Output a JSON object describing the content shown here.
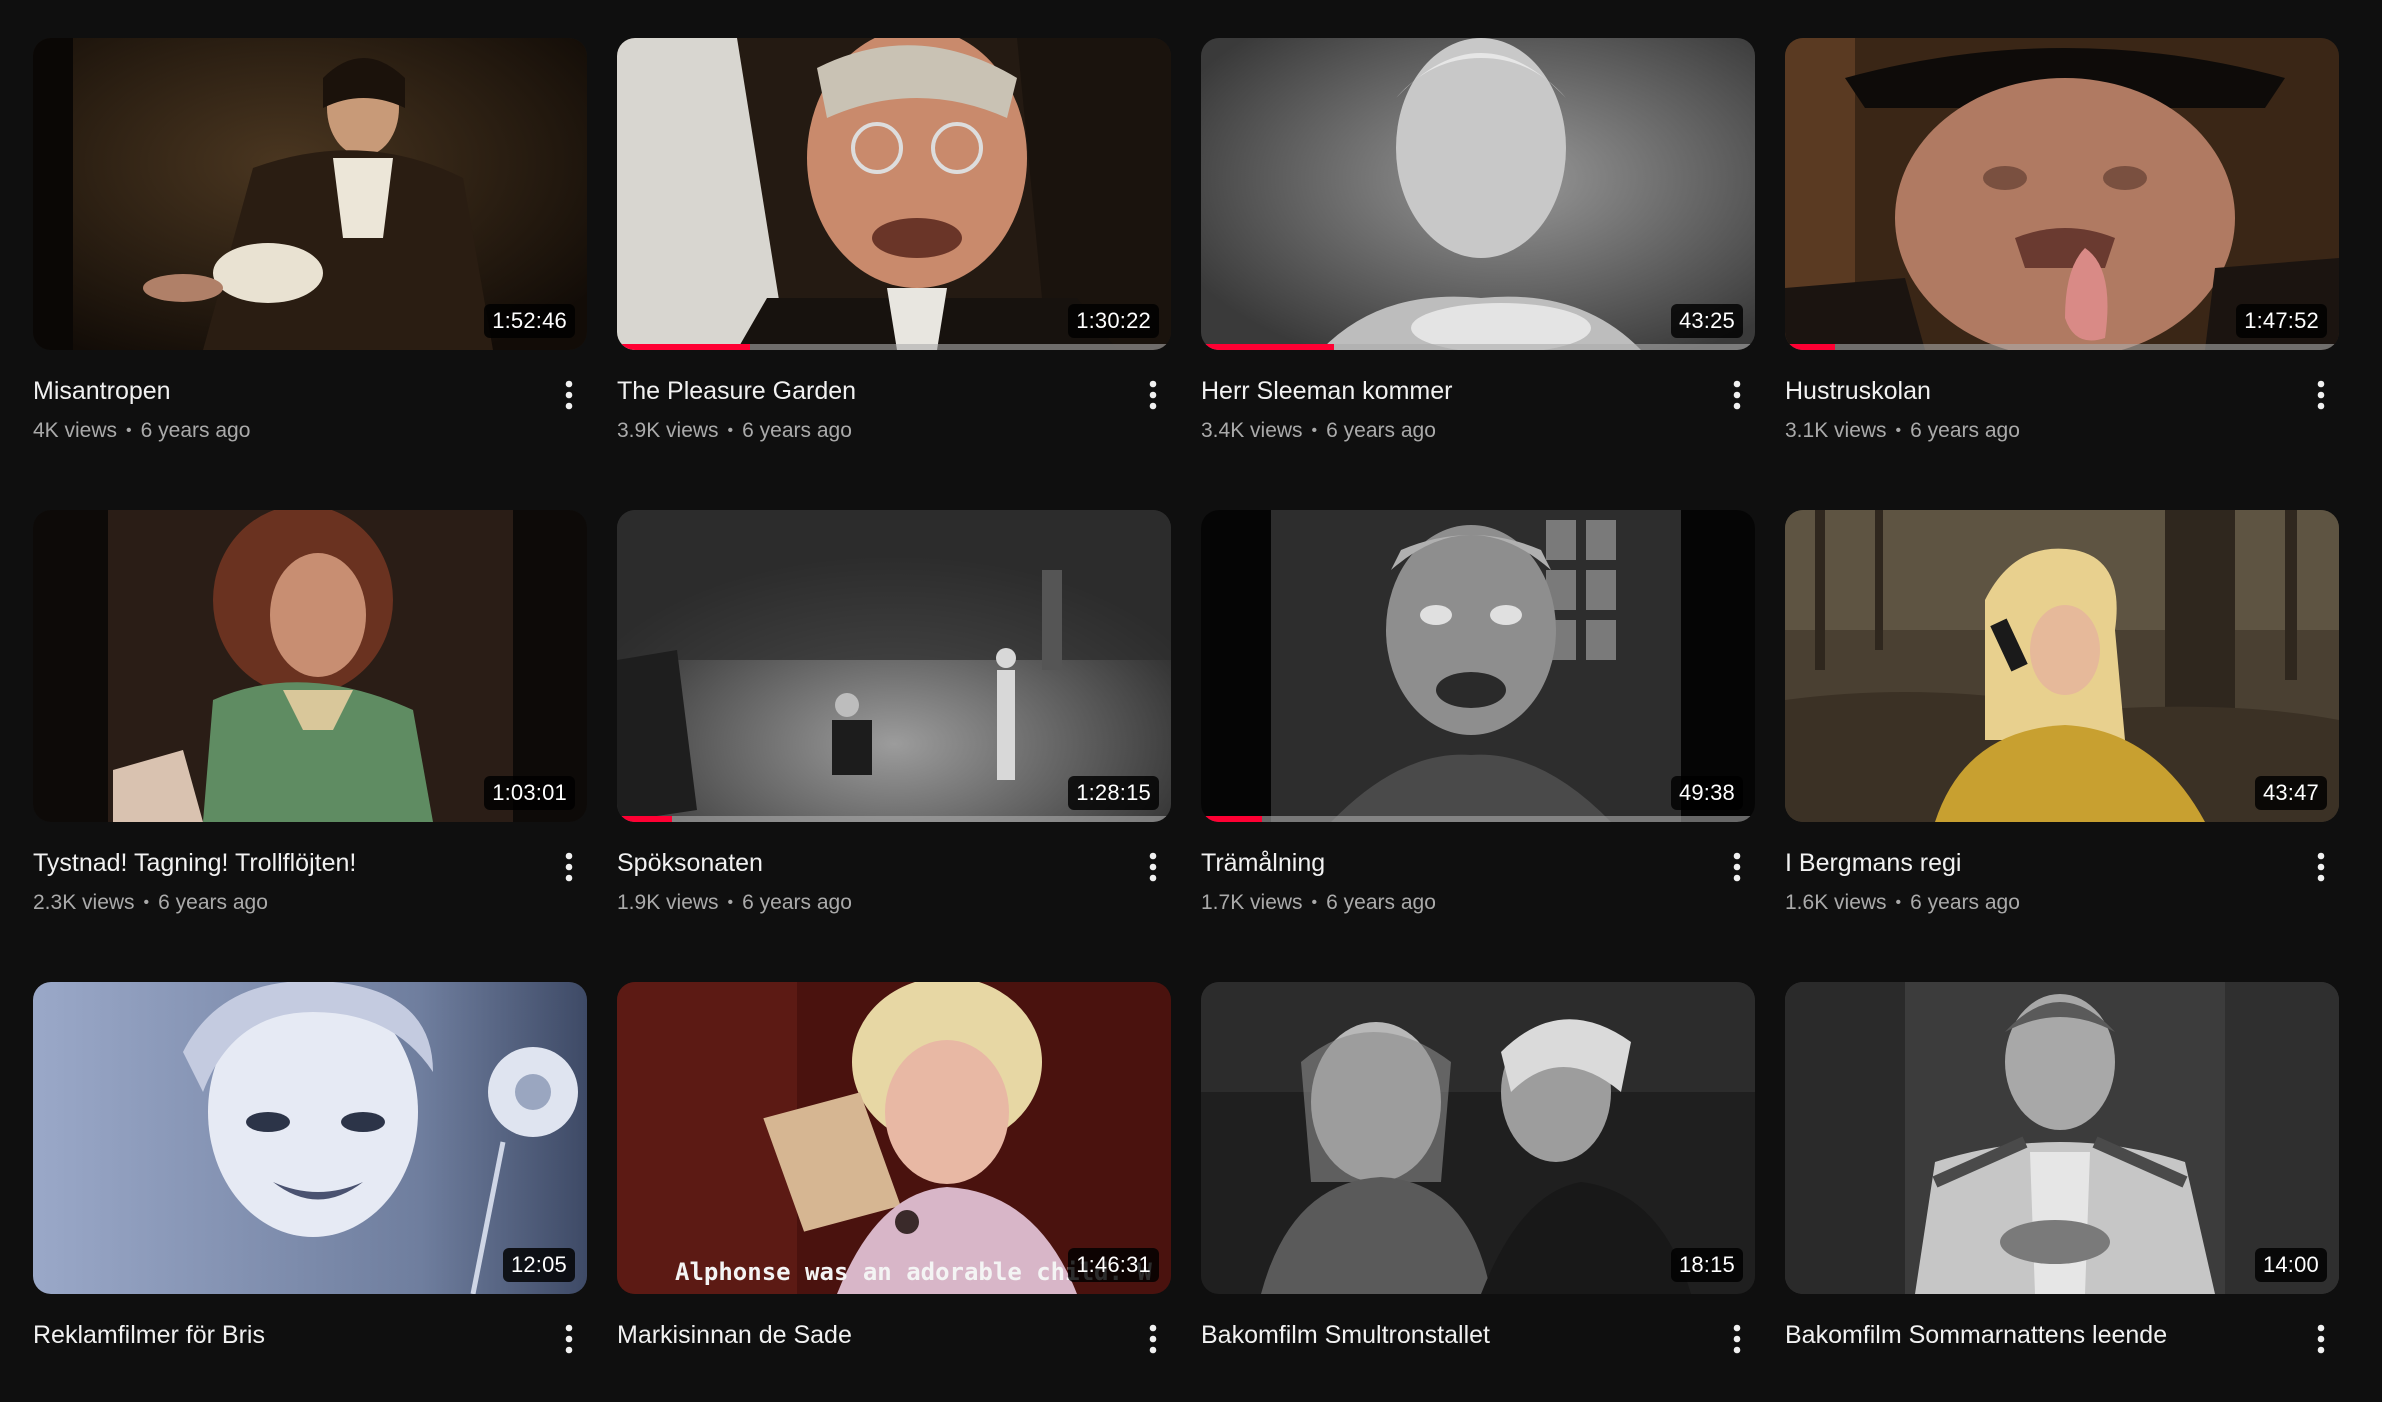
{
  "videos": [
    {
      "title": "Misantropen",
      "views": "4K views",
      "age": "6 years ago",
      "duration": "1:52:46",
      "watch_progress": 0
    },
    {
      "title": "The Pleasure Garden",
      "views": "3.9K views",
      "age": "6 years ago",
      "duration": "1:30:22",
      "watch_progress": 0.24
    },
    {
      "title": "Herr Sleeman kommer",
      "views": "3.4K views",
      "age": "6 years ago",
      "duration": "43:25",
      "watch_progress": 0.24
    },
    {
      "title": "Hustruskolan",
      "views": "3.1K views",
      "age": "6 years ago",
      "duration": "1:47:52",
      "watch_progress": 0.09
    },
    {
      "title": "Tystnad! Tagning! Trollflöjten!",
      "views": "2.3K views",
      "age": "6 years ago",
      "duration": "1:03:01",
      "watch_progress": 0
    },
    {
      "title": "Spöksonaten",
      "views": "1.9K views",
      "age": "6 years ago",
      "duration": "1:28:15",
      "watch_progress": 0.1
    },
    {
      "title": "Trämålning",
      "views": "1.7K views",
      "age": "6 years ago",
      "duration": "49:38",
      "watch_progress": 0.11
    },
    {
      "title": "I Bergmans regi",
      "views": "1.6K views",
      "age": "6 years ago",
      "duration": "43:47",
      "watch_progress": 0
    },
    {
      "title": "Reklamfilmer för Bris",
      "views": "",
      "age": "",
      "duration": "12:05",
      "watch_progress": 0
    },
    {
      "title": "Markisinnan de Sade",
      "views": "",
      "age": "",
      "duration": "1:46:31",
      "watch_progress": 0,
      "subtitle_text": "Alphonse was an adorable child. W"
    },
    {
      "title": "Bakomfilm Smultronstallet",
      "views": "",
      "age": "",
      "duration": "18:15",
      "watch_progress": 0
    },
    {
      "title": "Bakomfilm Sommarnattens leende",
      "views": "",
      "age": "",
      "duration": "14:00",
      "watch_progress": 0
    }
  ],
  "separator": "•",
  "icons": {
    "menu": "more-vert-icon"
  },
  "colors": {
    "background": "#0f0f0f",
    "progress": "#ff0033",
    "title": "#f1f1f1",
    "meta": "#aaaaaa"
  }
}
